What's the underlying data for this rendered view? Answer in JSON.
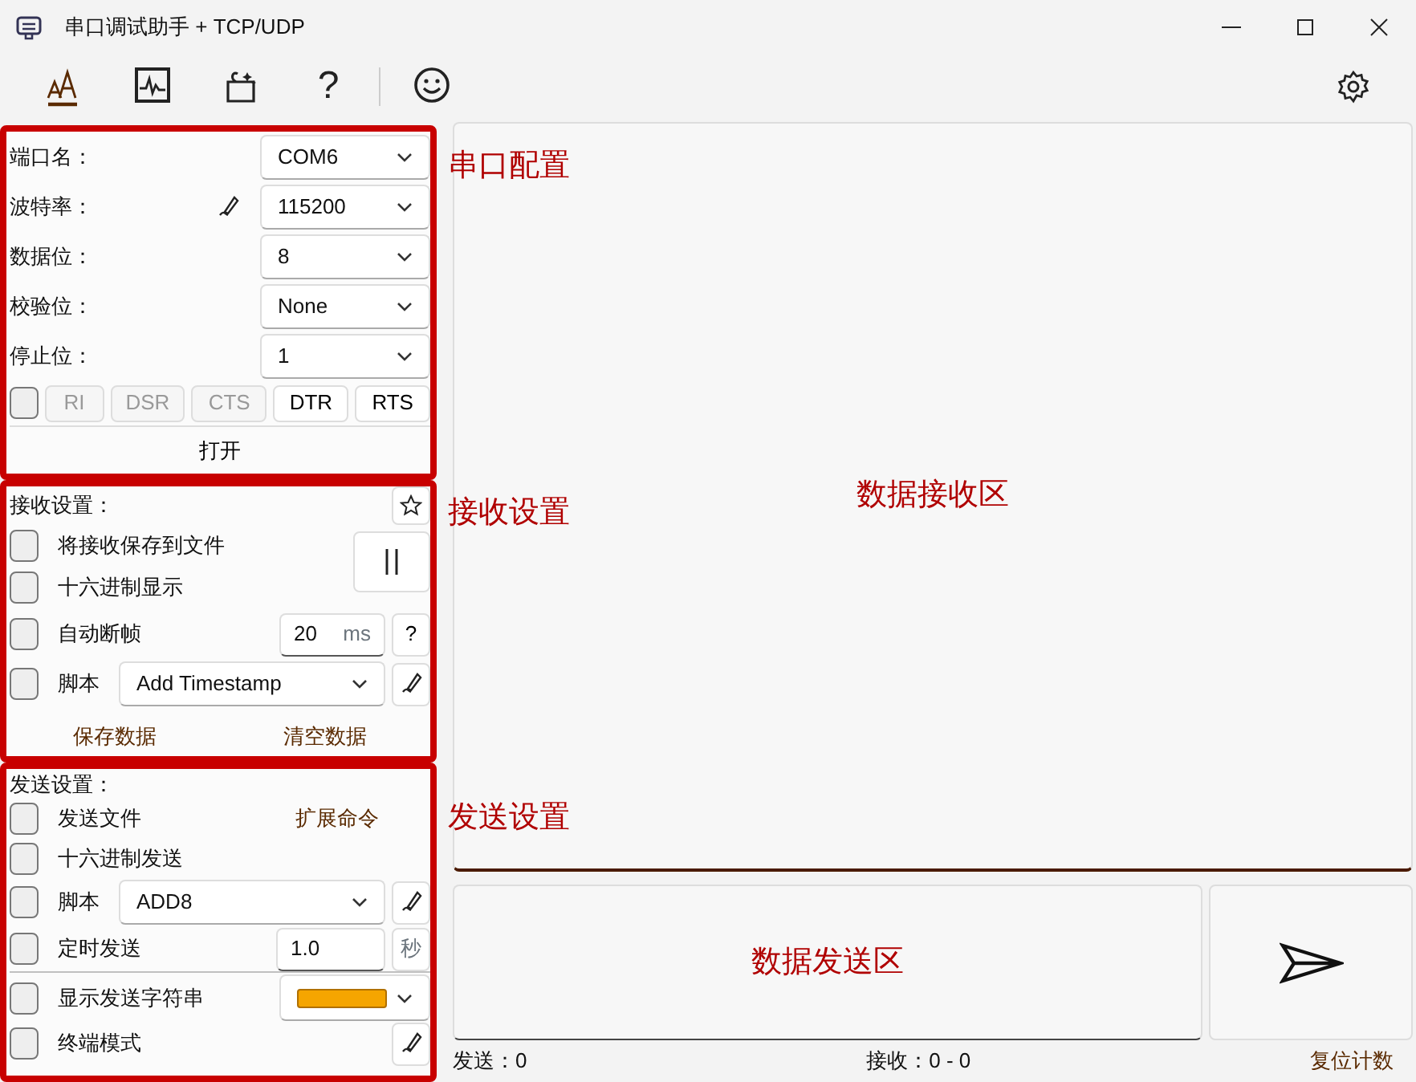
{
  "window": {
    "title": "串口调试助手 + TCP/UDP"
  },
  "toolbar": {
    "tools": [
      {
        "kind": "font",
        "selected": true
      },
      {
        "kind": "chart",
        "selected": false
      },
      {
        "kind": "plugin",
        "selected": false
      },
      {
        "kind": "help",
        "glyph": "?",
        "selected": false
      },
      {
        "kind": "emoji",
        "selected": false
      }
    ]
  },
  "serial_config": {
    "fields": [
      {
        "label": "端口名：",
        "value": "COM6",
        "editable": false
      },
      {
        "label": "波特率：",
        "value": "115200",
        "editable": true
      },
      {
        "label": "数据位：",
        "value": "8",
        "editable": false
      },
      {
        "label": "校验位：",
        "value": "None",
        "editable": false
      },
      {
        "label": "停止位：",
        "value": "1",
        "editable": false
      }
    ],
    "signal_checkbox": {
      "checked": false
    },
    "signals": [
      {
        "label": "RI",
        "disabled": true
      },
      {
        "label": "DSR",
        "disabled": true
      },
      {
        "label": "CTS",
        "disabled": true
      },
      {
        "label": "DTR",
        "disabled": false
      },
      {
        "label": "RTS",
        "disabled": false
      }
    ],
    "open_button": "打开"
  },
  "receive_settings": {
    "title": "接收设置：",
    "save_to_file": {
      "label": "将接收保存到文件",
      "checked": false
    },
    "hex_display": {
      "label": "十六进制显示",
      "checked": false
    },
    "auto_frame": {
      "label": "自动断帧",
      "checked": false,
      "value": "20",
      "unit": "ms",
      "help": "?"
    },
    "script": {
      "label": "脚本",
      "checked": false,
      "value": "Add Timestamp"
    },
    "actions": [
      "保存数据",
      "清空数据"
    ]
  },
  "send_settings": {
    "title": "发送设置：",
    "send_file": {
      "label": "发送文件",
      "checked": false
    },
    "extended_command": "扩展命令",
    "hex_send": {
      "label": "十六进制发送",
      "checked": false
    },
    "script": {
      "label": "脚本",
      "checked": false,
      "value": "ADD8"
    },
    "timed_send": {
      "label": "定时发送",
      "checked": false,
      "value": "1.0",
      "unit": "秒"
    },
    "show_string": {
      "label": "显示发送字符串",
      "checked": false,
      "color": "#f5a500"
    },
    "terminal_mode": {
      "label": "终端模式",
      "checked": false
    }
  },
  "annotations": [
    "串口配置",
    "接收设置",
    "发送设置"
  ],
  "receive_area": {
    "label": "数据接收区"
  },
  "send_area": {
    "label": "数据发送区"
  },
  "status_bar": {
    "sent": "发送：0",
    "received": "接收：0 - 0",
    "reset": "复位计数"
  }
}
